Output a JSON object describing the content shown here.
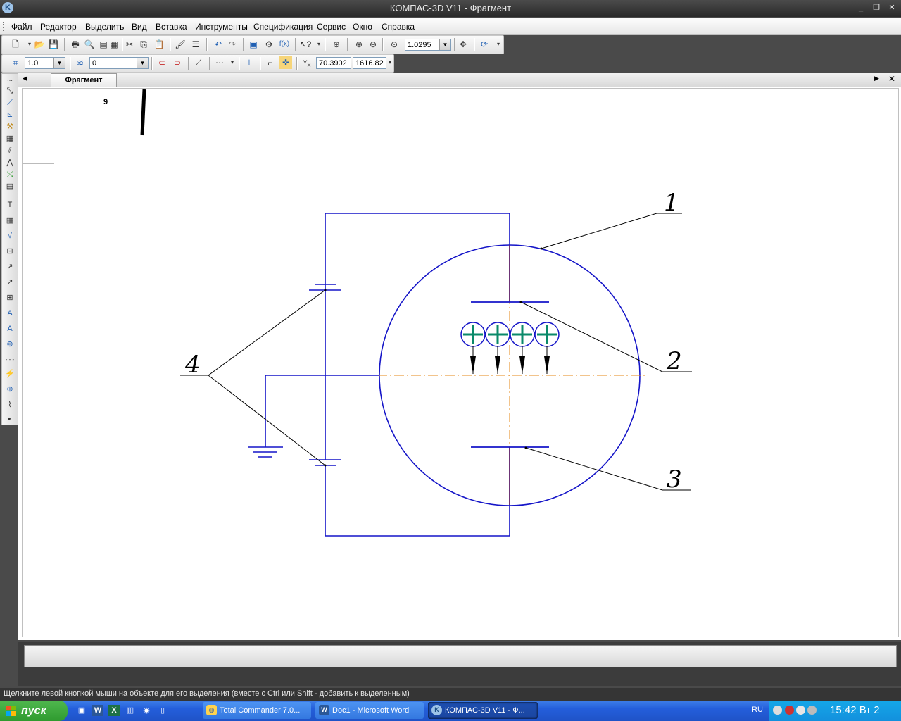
{
  "window": {
    "title": "КОМПАС-3D V11 - Фрагмент",
    "minimize": "_",
    "restore": "❐",
    "close": "✕"
  },
  "menu": [
    "Файл",
    "Редактор",
    "Выделить",
    "Вид",
    "Вставка",
    "Инструменты",
    "Спецификация",
    "Сервис",
    "Окно",
    "Справка"
  ],
  "toolbar1": {
    "zoom_value": "1.0295"
  },
  "toolbar2": {
    "step_value": "1.0",
    "layer_value": "0",
    "coord_x": "70.3902",
    "coord_y": "1616.82",
    "coord_label": "Y",
    "coord_label_x": "X"
  },
  "document": {
    "tab_label": "Фрагмент"
  },
  "drawing": {
    "corner_text": "9",
    "callouts": [
      "1",
      "2",
      "3",
      "4"
    ],
    "colors": {
      "lines": "#1515c8",
      "axis": "#e58a1a",
      "ion": "#0a8a6a",
      "leader": "#000000"
    }
  },
  "status": {
    "hint": "Щелкните левой кнопкой мыши на объекте для его выделения (вместе с Ctrl или Shift - добавить к выделенным)"
  },
  "taskbar": {
    "start_label": "пуск",
    "tasks": [
      "Total Commander 7.0...",
      "Doc1 - Microsoft Word",
      "КОМПАС-3D V11 - Ф..."
    ],
    "lang": "RU",
    "clock": "15:42 Вт 2"
  }
}
